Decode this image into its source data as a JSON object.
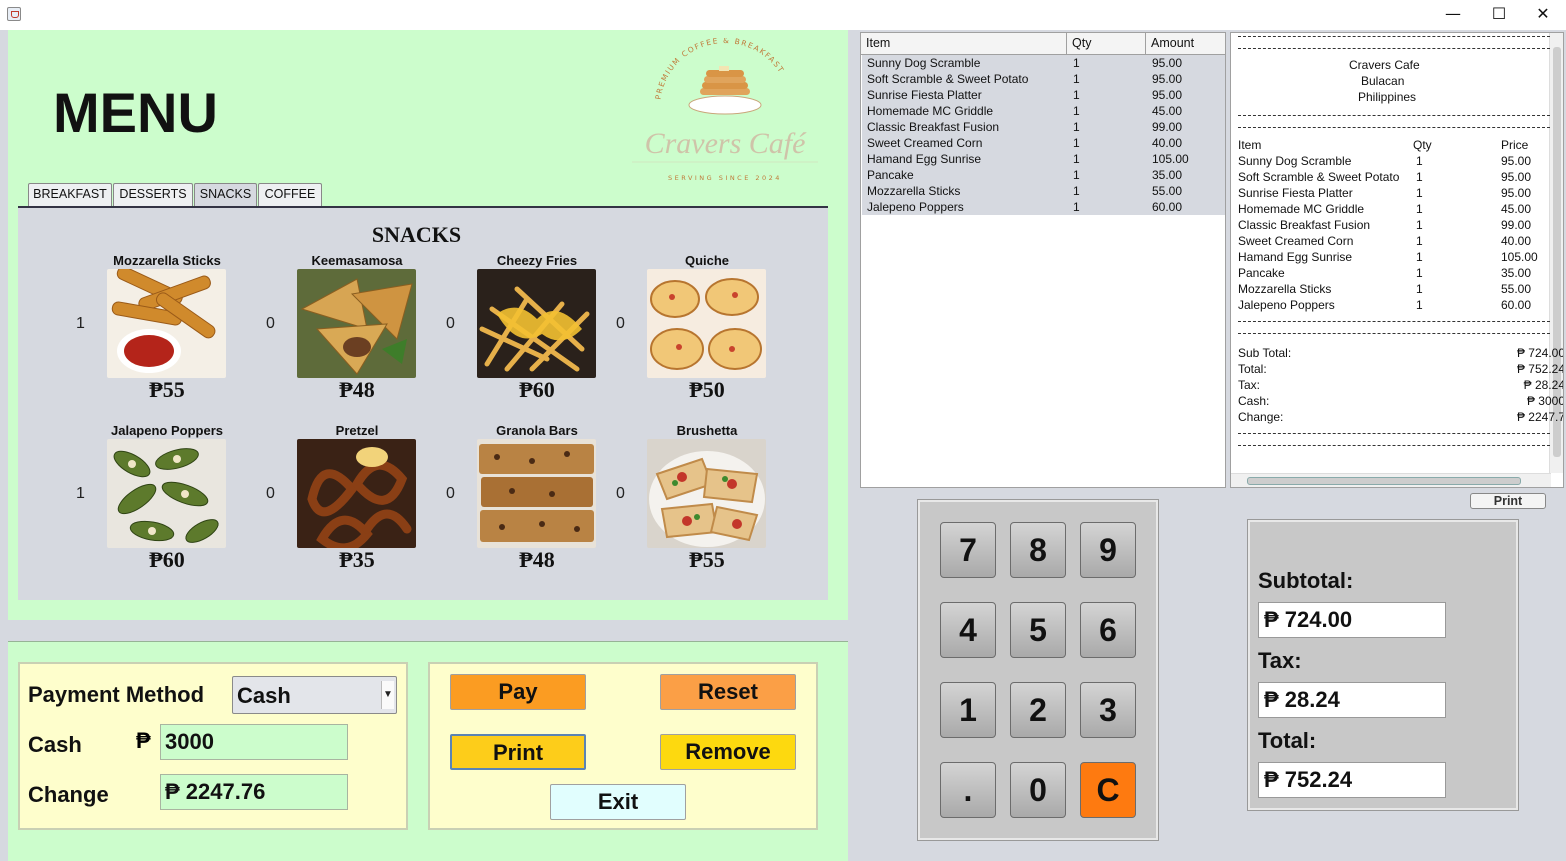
{
  "window": {
    "min_glyph": "—",
    "max_glyph": "☐",
    "close_glyph": "✕"
  },
  "menu": {
    "title": "MENU",
    "logo": {
      "name": "Cravers Café",
      "tagline": "PREMIUM COFFEE & BREAKFAST",
      "subline": "SERVING SINCE 2024"
    },
    "tabs": [
      "BREAKFAST",
      "DESSERTS",
      "SNACKS",
      "COFFEE"
    ],
    "active_tab": "SNACKS",
    "section_heading": "SNACKS",
    "items": [
      {
        "name": "Mozzarella Sticks",
        "price": "₱55",
        "qty": "1"
      },
      {
        "name": "Keemasamosa",
        "price": "₱48",
        "qty": "0"
      },
      {
        "name": "Cheezy Fries",
        "price": "₱60",
        "qty": "0"
      },
      {
        "name": "Quiche",
        "price": "₱50",
        "qty": "0"
      },
      {
        "name": "Jalapeno Poppers",
        "price": "₱60",
        "qty": "1"
      },
      {
        "name": "Pretzel",
        "price": "₱35",
        "qty": "0"
      },
      {
        "name": "Granola Bars",
        "price": "₱48",
        "qty": "0"
      },
      {
        "name": "Brushetta",
        "price": "₱55",
        "qty": "0"
      }
    ]
  },
  "payment": {
    "method_label": "Payment Method",
    "method_value": "Cash",
    "cash_label": "Cash",
    "cash_currency": "₱",
    "cash_value": "3000",
    "change_label": "Change",
    "change_value": "₱ 2247.76"
  },
  "actions": {
    "pay": "Pay",
    "reset": "Reset",
    "print": "Print",
    "remove": "Remove",
    "exit": "Exit"
  },
  "order_table": {
    "headers": [
      "Item",
      "Qty",
      "Amount"
    ],
    "rows": [
      {
        "item": "Sunny Dog Scramble",
        "qty": "1",
        "amount": "95.00"
      },
      {
        "item": "Soft Scramble & Sweet Potato",
        "qty": "1",
        "amount": "95.00"
      },
      {
        "item": "Sunrise Fiesta Platter",
        "qty": "1",
        "amount": "95.00"
      },
      {
        "item": "Homemade MC Griddle",
        "qty": "1",
        "amount": "45.00"
      },
      {
        "item": "Classic Breakfast Fusion",
        "qty": "1",
        "amount": "99.00"
      },
      {
        "item": "Sweet Creamed Corn",
        "qty": "1",
        "amount": "40.00"
      },
      {
        "item": "Hamand Egg Sunrise",
        "qty": "1",
        "amount": "105.00"
      },
      {
        "item": "Pancake",
        "qty": "1",
        "amount": "35.00"
      },
      {
        "item": "Mozzarella Sticks",
        "qty": "1",
        "amount": "55.00"
      },
      {
        "item": "Jalepeno Poppers",
        "qty": "1",
        "amount": "60.00"
      }
    ]
  },
  "receipt": {
    "shop": "Cravers Cafe",
    "city": "Bulacan",
    "country": "Philippines",
    "headers": [
      "Item",
      "Qty",
      "Price"
    ],
    "rows": [
      {
        "item": "Sunny Dog Scramble",
        "qty": "1",
        "price": "95.00"
      },
      {
        "item": "Soft Scramble & Sweet Potato",
        "qty": "1",
        "price": "95.00"
      },
      {
        "item": "Sunrise Fiesta Platter",
        "qty": "1",
        "price": "95.00"
      },
      {
        "item": "Homemade MC Griddle",
        "qty": "1",
        "price": "45.00"
      },
      {
        "item": "Classic Breakfast Fusion",
        "qty": "1",
        "price": "99.00"
      },
      {
        "item": "Sweet Creamed Corn",
        "qty": "1",
        "price": "40.00"
      },
      {
        "item": "Hamand Egg Sunrise",
        "qty": "1",
        "price": "105.00"
      },
      {
        "item": "Pancake",
        "qty": "1",
        "price": "35.00"
      },
      {
        "item": "Mozzarella Sticks",
        "qty": "1",
        "price": "55.00"
      },
      {
        "item": "Jalepeno Poppers",
        "qty": "1",
        "price": "60.00"
      }
    ],
    "summary": [
      {
        "label": "Sub Total:",
        "value": "₱ 724.00"
      },
      {
        "label": "Total:",
        "value": "₱ 752.24"
      },
      {
        "label": "Tax:",
        "value": "₱ 28.24"
      },
      {
        "label": "Cash:",
        "value": "₱ 3000"
      },
      {
        "label": "Change:",
        "value": "₱ 2247.7"
      }
    ],
    "print_label": "Print"
  },
  "keypad": {
    "keys": [
      "7",
      "8",
      "9",
      "4",
      "5",
      "6",
      "1",
      "2",
      "3",
      ".",
      "0",
      "C"
    ]
  },
  "totals": {
    "subtotal_label": "Subtotal:",
    "subtotal_value": "₱ 724.00",
    "tax_label": "Tax:",
    "tax_value": "₱ 28.24",
    "total_label": "Total:",
    "total_value": "₱ 752.24"
  }
}
